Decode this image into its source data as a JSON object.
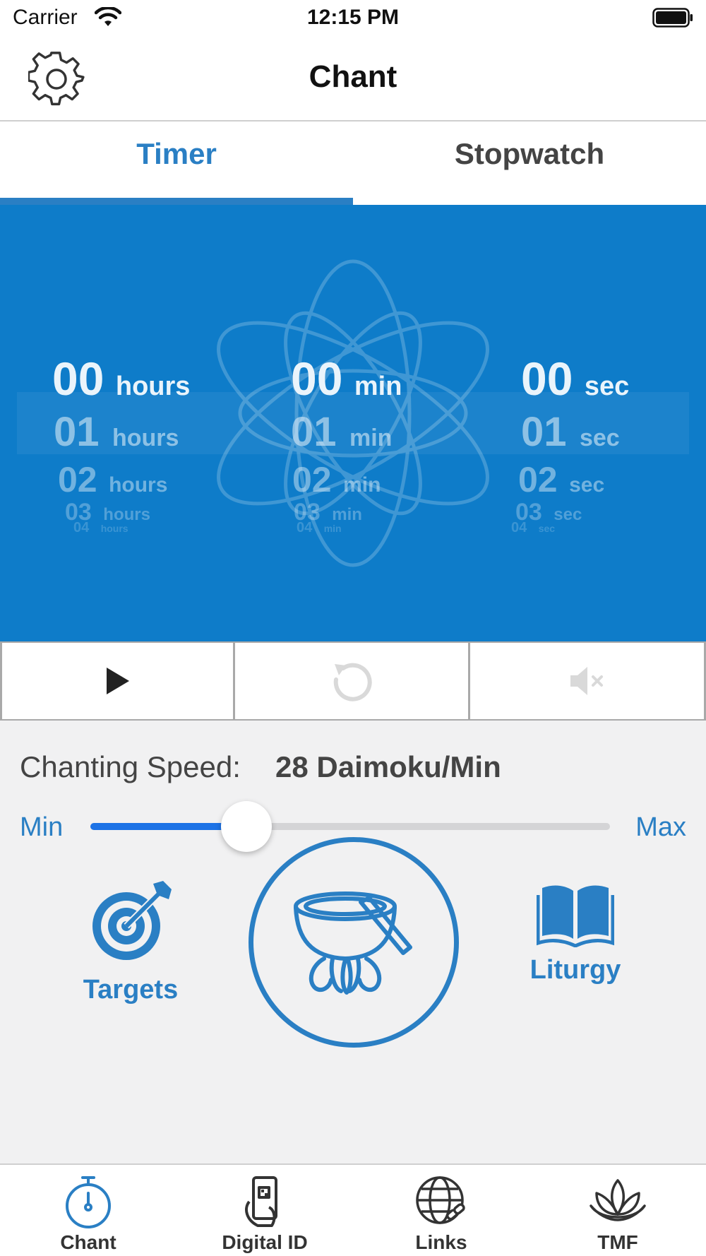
{
  "status_bar": {
    "carrier": "Carrier",
    "time": "12:15 PM",
    "wifi_icon": "wifi-icon",
    "battery_icon": "battery-icon"
  },
  "nav": {
    "title": "Chant",
    "settings_icon": "gear-icon"
  },
  "tabs": {
    "timer": "Timer",
    "stopwatch": "Stopwatch",
    "active": "Timer"
  },
  "timer": {
    "hours": [
      {
        "num": "00",
        "unit": "hours"
      },
      {
        "num": "01",
        "unit": "hours"
      },
      {
        "num": "02",
        "unit": "hours"
      },
      {
        "num": "03",
        "unit": "hours"
      },
      {
        "num": "04",
        "unit": "hours"
      }
    ],
    "minutes": [
      {
        "num": "00",
        "unit": "min"
      },
      {
        "num": "01",
        "unit": "min"
      },
      {
        "num": "02",
        "unit": "min"
      },
      {
        "num": "03",
        "unit": "min"
      },
      {
        "num": "04",
        "unit": "min"
      }
    ],
    "seconds": [
      {
        "num": "00",
        "unit": "sec"
      },
      {
        "num": "01",
        "unit": "sec"
      },
      {
        "num": "02",
        "unit": "sec"
      },
      {
        "num": "03",
        "unit": "sec"
      },
      {
        "num": "04",
        "unit": "sec"
      }
    ]
  },
  "controls": {
    "play_icon": "play-icon",
    "reset_icon": "reset-icon",
    "mute_icon": "mute-icon"
  },
  "speed": {
    "label": "Chanting Speed:",
    "value": "28 Daimoku/Min",
    "slider_min_label": "Min",
    "slider_max_label": "Max",
    "slider_fraction": 0.3
  },
  "actions": {
    "targets_label": "Targets",
    "liturgy_label": "Liturgy",
    "bell_icon": "singing-bowl-icon"
  },
  "tabbar": {
    "items": [
      {
        "label": "Chant",
        "icon": "stopwatch-icon",
        "active": true
      },
      {
        "label": "Digital ID",
        "icon": "phone-id-icon",
        "active": false
      },
      {
        "label": "Links",
        "icon": "globe-link-icon",
        "active": false
      },
      {
        "label": "TMF",
        "icon": "lotus-icon",
        "active": false
      }
    ]
  },
  "colors": {
    "accent": "#2a7fc4",
    "timer_bg": "#0e7cc9",
    "slider_fill": "#1d73e6"
  }
}
